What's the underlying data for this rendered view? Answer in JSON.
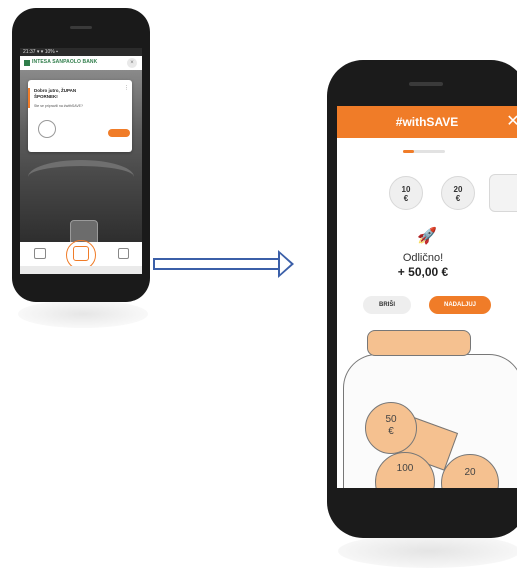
{
  "left_phone": {
    "status_bar": "21:37 ▾  ▾ 10% ▪",
    "bank_name": "INTESA SANPAOLO BANK",
    "close_icon": "×",
    "card": {
      "title": "Dobro jutro, ŽUPAN ŠPORNEK!",
      "subtitle": "Ste se pripravili na #withSAVE?",
      "menu_icon": "⋮"
    },
    "tab_icons": [
      "wallet-icon",
      "savings-icon",
      "cards-icon"
    ]
  },
  "arrow_icon": "right-arrow",
  "right_phone": {
    "header_title": "#withSAVE",
    "close_icon": "✕",
    "progress": 0.25,
    "coins": [
      {
        "value": "10",
        "unit": "€"
      },
      {
        "value": "20",
        "unit": "€"
      }
    ],
    "rocket_icon": "🚀",
    "message": "Odlično!",
    "amount": "+ 50,00 €",
    "delete_label": "BRIŠI",
    "continue_label": "NADALJUJ",
    "jar_coins": [
      {
        "value": "50",
        "unit": "€"
      },
      {
        "value": "100"
      },
      {
        "value": "20"
      }
    ]
  },
  "colors": {
    "accent": "#f07c28",
    "bank_green": "#2f7d4a",
    "arrow": "#3b5fa8"
  }
}
